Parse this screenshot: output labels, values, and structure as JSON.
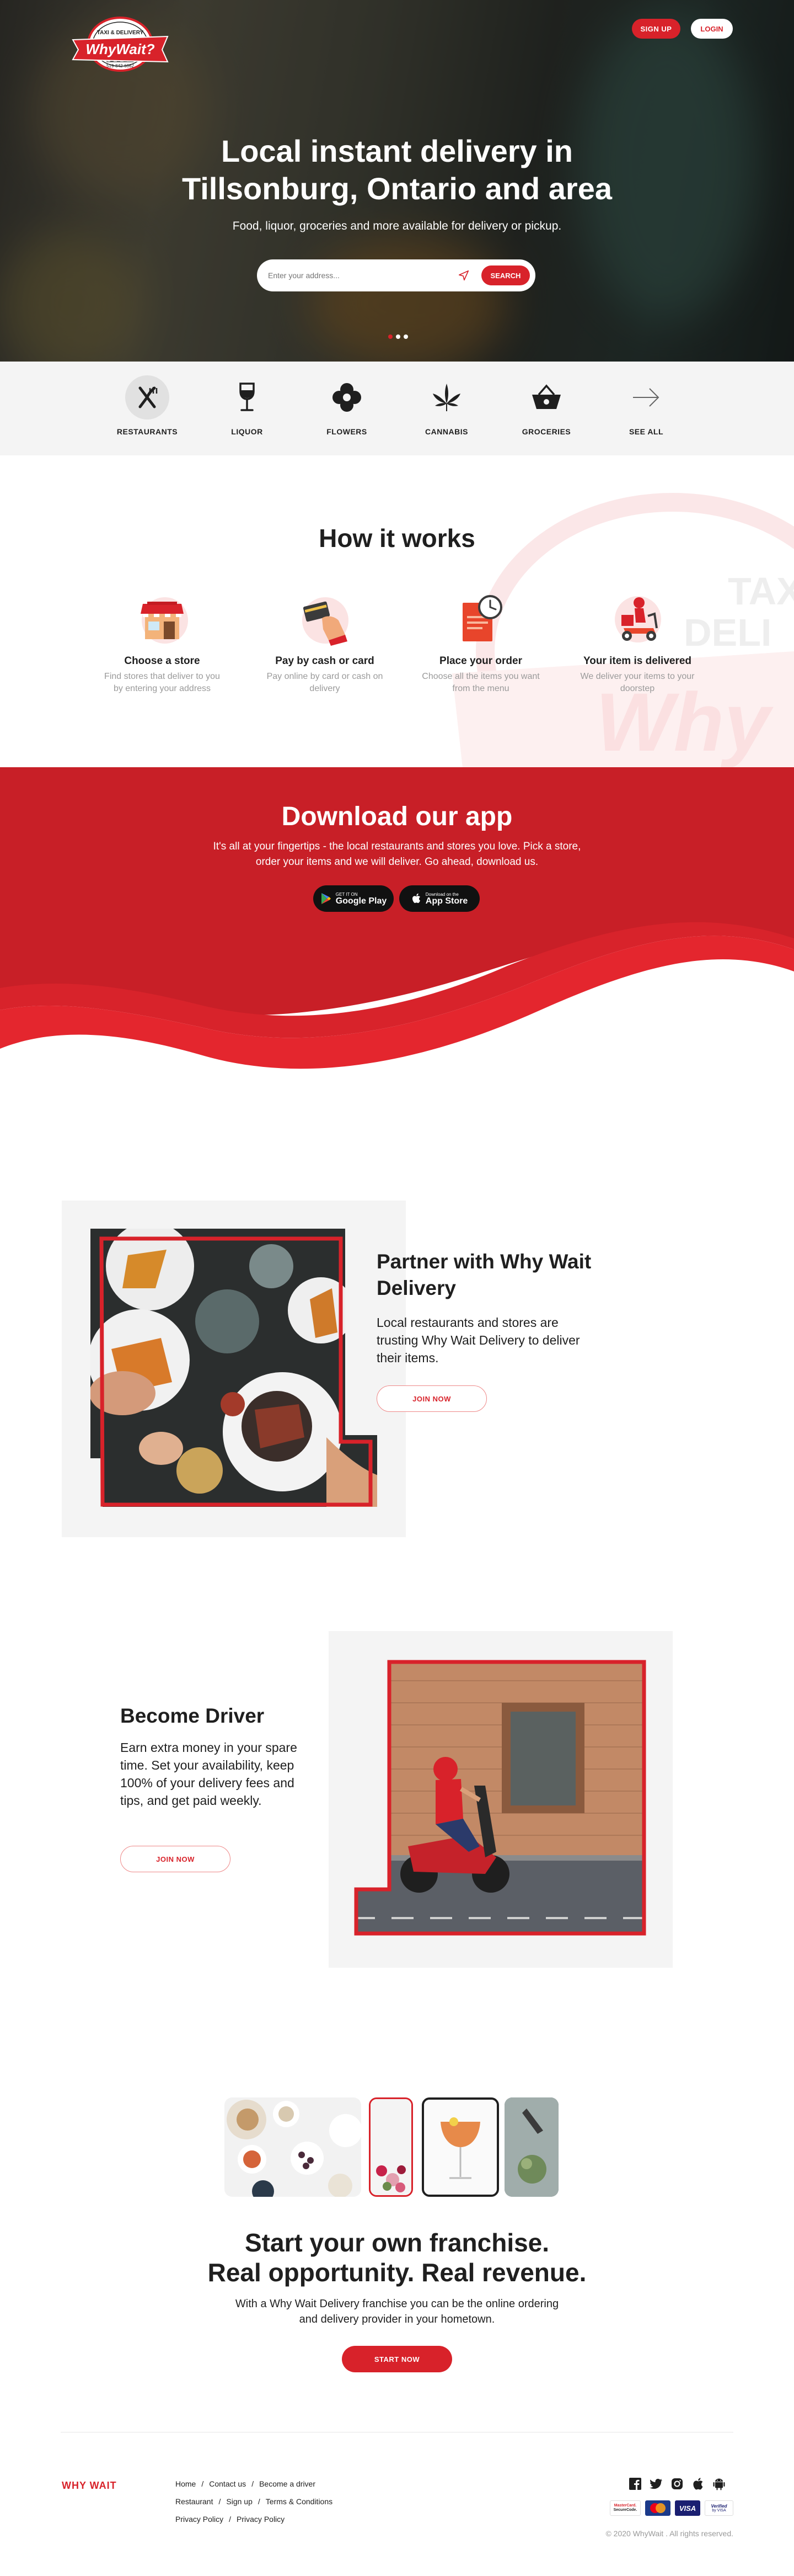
{
  "header": {
    "logo_text": "WhyWait?",
    "logo_top": "TAXI & DELIVERY",
    "logo_bottom": "519-842-6662",
    "signup": "SIGN UP",
    "login": "LOGIN"
  },
  "hero": {
    "title_line1": "Local instant delivery in",
    "title_line2": "Tillsonburg, Ontario and area",
    "subtitle": "Food, liquor, groceries and more available for delivery or pickup.",
    "search_placeholder": "Enter your address...",
    "search_button": "SEARCH",
    "slides": 3,
    "active_slide": 2
  },
  "categories": [
    {
      "label": "RESTAURANTS",
      "icon": "fork-knife-icon"
    },
    {
      "label": "LIQUOR",
      "icon": "wine-glass-icon"
    },
    {
      "label": "FLOWERS",
      "icon": "flower-icon"
    },
    {
      "label": "CANNABIS",
      "icon": "cannabis-leaf-icon"
    },
    {
      "label": "GROCERIES",
      "icon": "basket-icon"
    },
    {
      "label": "SEE ALL",
      "icon": "arrow-right-icon"
    }
  ],
  "how_it_works": {
    "title": "How it works",
    "watermark_1": "TAX",
    "watermark_2": "DELI",
    "watermark_3": "Why",
    "steps": [
      {
        "title": "Choose a store",
        "text": "Find stores that deliver to you by entering your address",
        "icon": "store-illustration"
      },
      {
        "title": "Pay by cash or card",
        "text": "Pay online by card or cash on delivery",
        "icon": "card-payment-illustration"
      },
      {
        "title": "Place your order",
        "text": "Choose all the items you want from the menu",
        "icon": "order-clock-illustration"
      },
      {
        "title": "Your item is delivered",
        "text": "We deliver your items to your doorstep",
        "icon": "delivery-scooter-illustration"
      }
    ]
  },
  "app": {
    "title": "Download our app",
    "text": "It's all at your fingertips - the local restaurants and stores you love. Pick a store, order your items and we will deliver. Go ahead, download us.",
    "google_small": "GET IT ON",
    "google_big": "Google Play",
    "apple_small": "Download on the",
    "apple_big": "App Store"
  },
  "partner": {
    "title": "Partner with Why Wait Delivery",
    "text": "Local restaurants and stores are trusting Why Wait Delivery to deliver their items.",
    "button": "JOIN NOW"
  },
  "driver": {
    "title": "Become Driver",
    "text": "Earn extra money in your spare time. Set your availability, keep 100% of your delivery fees and tips, and get paid weekly.",
    "button": "JOIN NOW"
  },
  "franchise": {
    "title_line1": "Start your own franchise.",
    "title_line2": "Real opportunity. Real revenue.",
    "text": "With a Why Wait Delivery franchise you can be the online ordering and delivery provider in your hometown.",
    "button": "START NOW"
  },
  "footer": {
    "brand": "WHY WAIT",
    "links_row1": [
      "Home",
      "Contact us",
      "Become a driver"
    ],
    "links_row2": [
      "Restaurant",
      "Sign up",
      "Terms & Conditions"
    ],
    "links_row3": [
      "Privacy Policy",
      "Privacy Policy"
    ],
    "separator": "/",
    "social": [
      "facebook-icon",
      "twitter-icon",
      "instagram-icon",
      "apple-icon",
      "android-icon"
    ],
    "payments": [
      "MasterCard SecureCode",
      "mastercard-icon",
      "VISA",
      "Verified by VISA"
    ],
    "pay_labels": {
      "mc_secure_1": "MasterCard.",
      "mc_secure_2": "SecureCode.",
      "visa": "VISA",
      "vbv_1": "Verified",
      "vbv_2": "by VISA"
    },
    "copyright": "© 2020 WhyWait . All rights reserved."
  },
  "colors": {
    "brand_red": "#d8222a",
    "light_gray": "#f4f4f4",
    "text_gray": "#9a9a9a"
  }
}
